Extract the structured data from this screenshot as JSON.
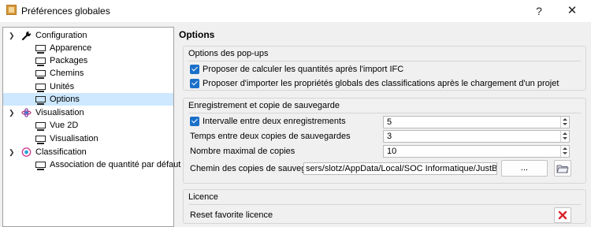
{
  "window": {
    "title": "Préférences globales",
    "help_label": "?",
    "close_label": "✕"
  },
  "tree": {
    "items": [
      {
        "label": "Configuration",
        "icon": "wrench-icon",
        "expanded": true
      },
      {
        "label": "Apparence",
        "icon": "monitor-icon"
      },
      {
        "label": "Packages",
        "icon": "monitor-icon"
      },
      {
        "label": "Chemins",
        "icon": "monitor-icon"
      },
      {
        "label": "Unités",
        "icon": "monitor-icon"
      },
      {
        "label": "Options",
        "icon": "monitor-icon",
        "selected": true
      },
      {
        "label": "Visualisation",
        "icon": "visualisation-icon",
        "expanded": true
      },
      {
        "label": "Vue 2D",
        "icon": "monitor-icon"
      },
      {
        "label": "Visualisation",
        "icon": "monitor-icon"
      },
      {
        "label": "Classification",
        "icon": "classification-icon",
        "expanded": true
      },
      {
        "label": "Association de quantité par défaut",
        "icon": "monitor-icon"
      }
    ]
  },
  "main": {
    "title": "Options",
    "popups": {
      "title": "Options des pop-ups",
      "check1": {
        "label": "Proposer de calculer les quantités après l'import IFC",
        "checked": true
      },
      "check2": {
        "label": "Proposer d'importer les propriétés globals des classifications après le chargement d'un projet",
        "checked": true
      }
    },
    "backup": {
      "title": "Enregistrement et copie de sauvegarde",
      "interval": {
        "label": "Intervalle entre deux enregistrements",
        "checked": true,
        "value": "5"
      },
      "copies_time": {
        "label": "Temps entre deux copies de sauvegardes",
        "value": "3"
      },
      "max_copies": {
        "label": "Nombre maximal de copies",
        "value": "10"
      },
      "path": {
        "label": "Chemin des copies de sauvegardes",
        "value": "sers/slotz/AppData/Local/SOC Informatique/JustBIM/backup",
        "browse_label": "...",
        "folder_icon": "folder-icon"
      }
    },
    "licence": {
      "title": "Licence",
      "reset_label": "Reset favorite licence",
      "reset_icon": "red-x-icon"
    }
  },
  "colors": {
    "selection": "#cde8ff",
    "checkbox": "#1a6fc9",
    "danger": "#d9242b"
  }
}
